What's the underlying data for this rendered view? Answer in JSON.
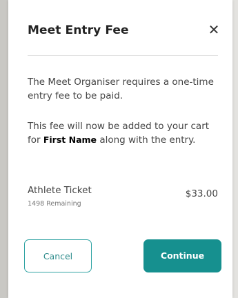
{
  "dialog": {
    "title": "Meet Entry Fee",
    "close_glyph": "✕",
    "message_1": "The Meet Organiser requires a one-time entry fee to be paid.",
    "message_2_prefix": "This fee will now be added to your cart for",
    "first_name": "First Name",
    "message_2_suffix": "along with the entry.",
    "ticket": {
      "name": "Athlete Ticket",
      "remaining": "1498 Remaining",
      "price": "$33.00"
    },
    "buttons": {
      "cancel": "Cancel",
      "continue": "Continue"
    }
  },
  "colors": {
    "accent": "#16908f",
    "accent_border": "#2fa3a3"
  },
  "icons": {
    "close": "close-icon"
  }
}
